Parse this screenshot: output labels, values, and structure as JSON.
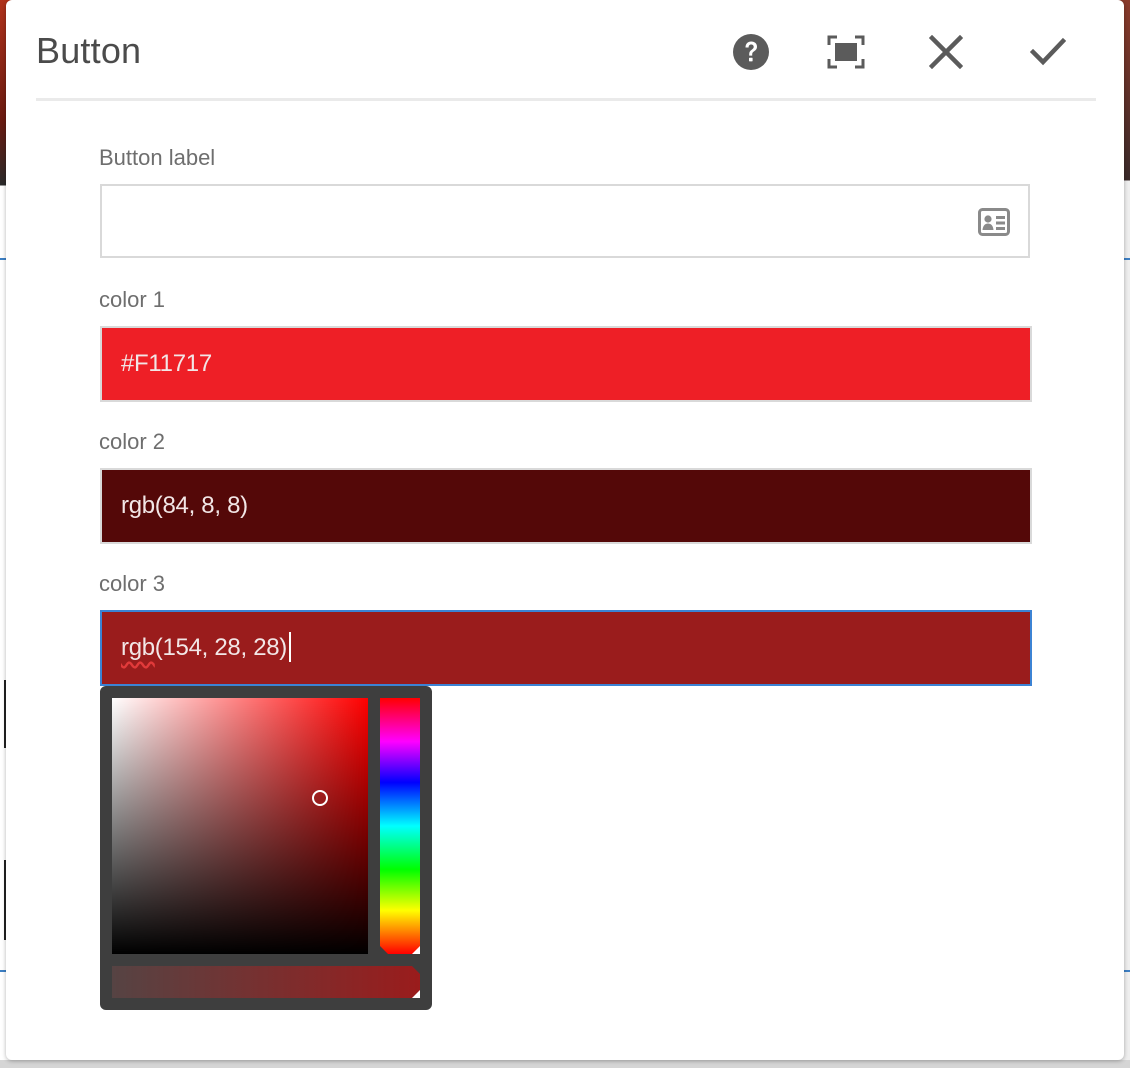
{
  "dialog": {
    "title": "Button",
    "actions": {
      "help": "help-icon",
      "fullscreen": "fullscreen-icon",
      "close": "close-icon",
      "done": "checkmark-icon"
    }
  },
  "fields": {
    "button_label": {
      "label": "Button label",
      "value": "",
      "placeholder": "",
      "icon": "contact-card-icon"
    },
    "color1": {
      "label": "color 1",
      "value": "#F11717",
      "swatch": "#EE1F26"
    },
    "color2": {
      "label": "color 2",
      "value": "rgb(84, 8, 8)",
      "swatch": "#540808"
    },
    "color3": {
      "label": "color 3",
      "value_prefix": "rgb",
      "value_rest": "(154, 28, 28)",
      "swatch": "#9A1C1C"
    }
  },
  "color_picker": {
    "hue_color": "#FF0000",
    "selected_color": "#9A1C1C"
  },
  "colors": {
    "title_text": "#4B4B4B",
    "label_text": "#6E6E6E",
    "focus_border": "#3C83D4",
    "picker_bg": "#3E3E3E"
  }
}
